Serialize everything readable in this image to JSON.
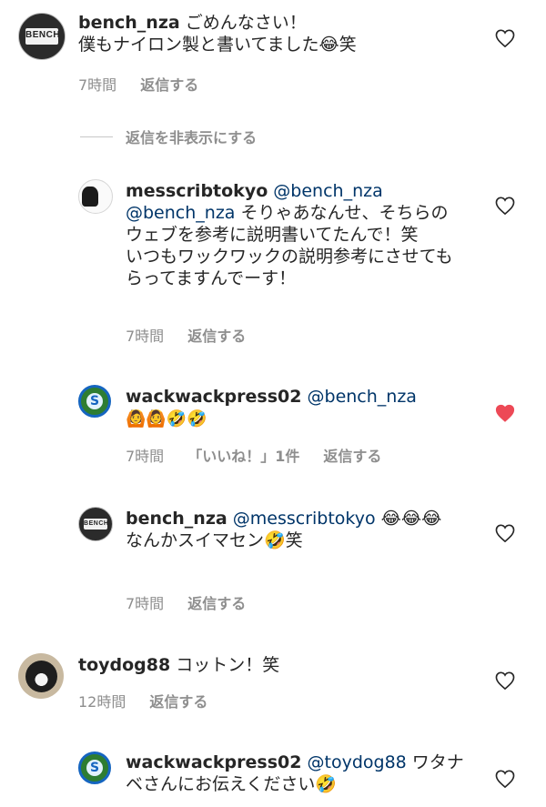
{
  "comments": [
    {
      "user": "bench_nza",
      "mention": "",
      "text_line1": " ごめんなさい！",
      "text_rest": "僕もナイロン製と書いてました😂笑",
      "time": "7時間",
      "reply": "返信する",
      "liked": false
    },
    {
      "user": "messcribtokyo",
      "mention": " @bench_nza",
      "mention2": "@bench_nza",
      "text": " そりゃあなんせ、そちらのウェブを参考に説明書いてたんで！笑",
      "text2": "いつもワックワックの説明参考にさせてもらってますんでーす！",
      "time": "7時間",
      "reply": "返信する",
      "liked": false
    },
    {
      "user": "wackwackpress02",
      "mention": " @bench_nza",
      "text": "🙆🙆🤣🤣",
      "time": "7時間",
      "likes": "「いいね！」1件",
      "reply": "返信する",
      "liked": true
    },
    {
      "user": "bench_nza",
      "mention": " @messcribtokyo",
      "text": " 😂😂😂",
      "text2": "なんかスイマセン🤣笑",
      "time": "7時間",
      "reply": "返信する",
      "liked": false
    },
    {
      "user": "toydog88",
      "text": " コットン！笑",
      "time": "12時間",
      "reply": "返信する",
      "liked": false
    },
    {
      "user": "wackwackpress02",
      "mention": " @toydog88",
      "text": " ワタナベさんにお伝えください🤣",
      "liked": false
    }
  ],
  "hide_replies": "返信を非表示にする",
  "icons": {
    "like": "heart-icon",
    "liked": "heart-filled-icon"
  },
  "colors": {
    "liked": "#ed4956",
    "meta": "#8e8e8e",
    "mention": "#003569"
  }
}
